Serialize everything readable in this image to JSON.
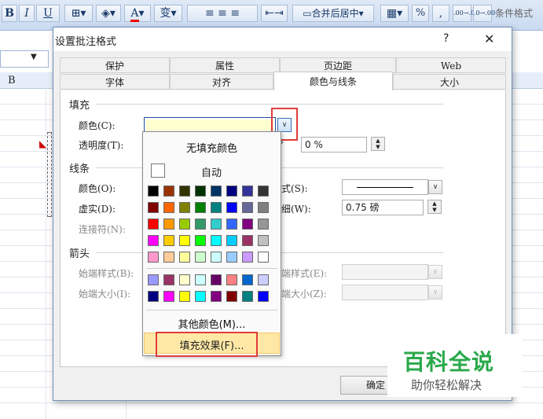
{
  "ribbon": {
    "bold": "B",
    "italic": "I",
    "underline": "U",
    "wen": "变",
    "merge_center": "合并后居中",
    "percent": "%",
    "comma": ",",
    "inc_decimal": ".00→.0",
    "dec_decimal": ".0→.00",
    "conditional_format": "条件格式"
  },
  "sheet": {
    "col_b": "B"
  },
  "dialog": {
    "title": "设置批注格式",
    "help": "?",
    "close": "✕",
    "tabs_row1": [
      "保护",
      "属性",
      "页边距",
      "Web"
    ],
    "tabs_row2": [
      "字体",
      "对齐",
      "颜色与线条",
      "大小"
    ],
    "active_tab": "颜色与线条",
    "fill": {
      "section": "填充",
      "color_label": "颜色(C):",
      "transparency_label": "透明度(T):",
      "transparency_value": "0 %",
      "fill_color": "#ffffd0"
    },
    "line": {
      "section": "线条",
      "color_label": "颜色(O):",
      "dash_label": "虚实(D):",
      "connector_label": "连接符(N):",
      "style_label": "式(S):",
      "weight_label": "细(W):",
      "weight_value": "0.75 磅"
    },
    "arrows": {
      "section": "箭头",
      "begin_style_label": "始端样式(B):",
      "begin_size_label": "始端大小(I):",
      "end_style_label": "端样式(E):",
      "end_size_label": "端大小(Z):"
    },
    "ok": "确定"
  },
  "popup": {
    "no_fill": "无填充颜色",
    "automatic": "自动",
    "more_colors": "其他颜色(M)...",
    "fill_effects": "填充效果(F)...",
    "palette": [
      [
        "#000000",
        "#993300",
        "#333300",
        "#003300",
        "#003366",
        "#000080",
        "#333399",
        "#333333"
      ],
      [
        "#800000",
        "#ff6600",
        "#808000",
        "#008000",
        "#008080",
        "#0000ff",
        "#666699",
        "#808080"
      ],
      [
        "#ff0000",
        "#ff9900",
        "#99cc00",
        "#339966",
        "#33cccc",
        "#3366ff",
        "#800080",
        "#969696"
      ],
      [
        "#ff00ff",
        "#ffcc00",
        "#ffff00",
        "#00ff00",
        "#00ffff",
        "#00ccff",
        "#993366",
        "#c0c0c0"
      ],
      [
        "#ff99cc",
        "#ffcc99",
        "#ffff99",
        "#ccffcc",
        "#ccffff",
        "#99ccff",
        "#cc99ff",
        "#ffffff"
      ]
    ],
    "palette2": [
      [
        "#9999ff",
        "#993366",
        "#ffffcc",
        "#ccffff",
        "#660066",
        "#ff8080",
        "#0066cc",
        "#ccccff"
      ],
      [
        "#000080",
        "#ff00ff",
        "#ffff00",
        "#00ffff",
        "#800080",
        "#800000",
        "#008080",
        "#0000ff"
      ]
    ]
  },
  "watermark": {
    "title": "百科全说",
    "subtitle": "助你轻松解决"
  },
  "colors": {
    "highlight_red": "#e03c3c",
    "menu_hover": "#ffe8a6",
    "watermark_green": "#2aa84a"
  }
}
